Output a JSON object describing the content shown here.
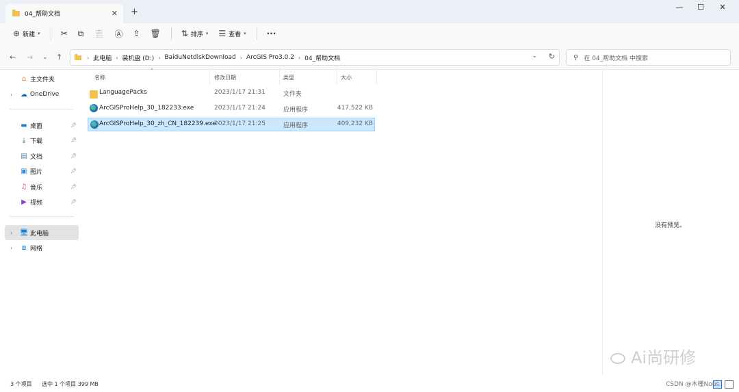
{
  "window": {
    "tab_title": "04_帮助文档",
    "tab_close": "✕",
    "new_tab": "+",
    "minimize": "—",
    "maximize": "☐",
    "close": "✕"
  },
  "toolbar": {
    "new_label": "新建",
    "sort_label": "排序",
    "view_label": "查看",
    "more": "···"
  },
  "address": {
    "crumbs": [
      "此电脑",
      "装机盘 (D:)",
      "BaiduNetdiskDownload",
      "ArcGIS Pro3.0.2",
      "04_帮助文档"
    ],
    "search_placeholder": "在 04_帮助文档 中搜索"
  },
  "sidebar": {
    "home": "主文件夹",
    "onedrive": "OneDrive",
    "quick": [
      {
        "label": "桌面",
        "icon": "desktop-icon"
      },
      {
        "label": "下载",
        "icon": "download-icon"
      },
      {
        "label": "文档",
        "icon": "document-icon"
      },
      {
        "label": "图片",
        "icon": "picture-icon"
      },
      {
        "label": "音乐",
        "icon": "music-icon"
      },
      {
        "label": "视频",
        "icon": "video-icon"
      }
    ],
    "this_pc": "此电脑",
    "network": "网络"
  },
  "columns": {
    "name": "名称",
    "date": "修改日期",
    "type": "类型",
    "size": "大小"
  },
  "files": [
    {
      "name": "LanguagePacks",
      "date": "2023/1/17 21:31",
      "type": "文件夹",
      "size": "",
      "kind": "folder"
    },
    {
      "name": "ArcGISProHelp_30_182233.exe",
      "date": "2023/1/17 21:24",
      "type": "应用程序",
      "size": "417,522 KB",
      "kind": "exe"
    },
    {
      "name": "ArcGISProHelp_30_zh_CN_182239.exe",
      "date": "2023/1/17 21:25",
      "type": "应用程序",
      "size": "409,232 KB",
      "kind": "exe",
      "selected": true
    }
  ],
  "preview": {
    "empty_text": "没有预览。"
  },
  "status": {
    "count": "3 个项目",
    "selection": "选中 1 个项目  399 MB"
  },
  "watermark": {
    "brand": "Ai尚研修",
    "csdn": "CSDN @木槿Nous"
  },
  "colors": {
    "accent": "#0067c0",
    "selected_row": "#cce8ff",
    "folder": "#f3c14f"
  }
}
